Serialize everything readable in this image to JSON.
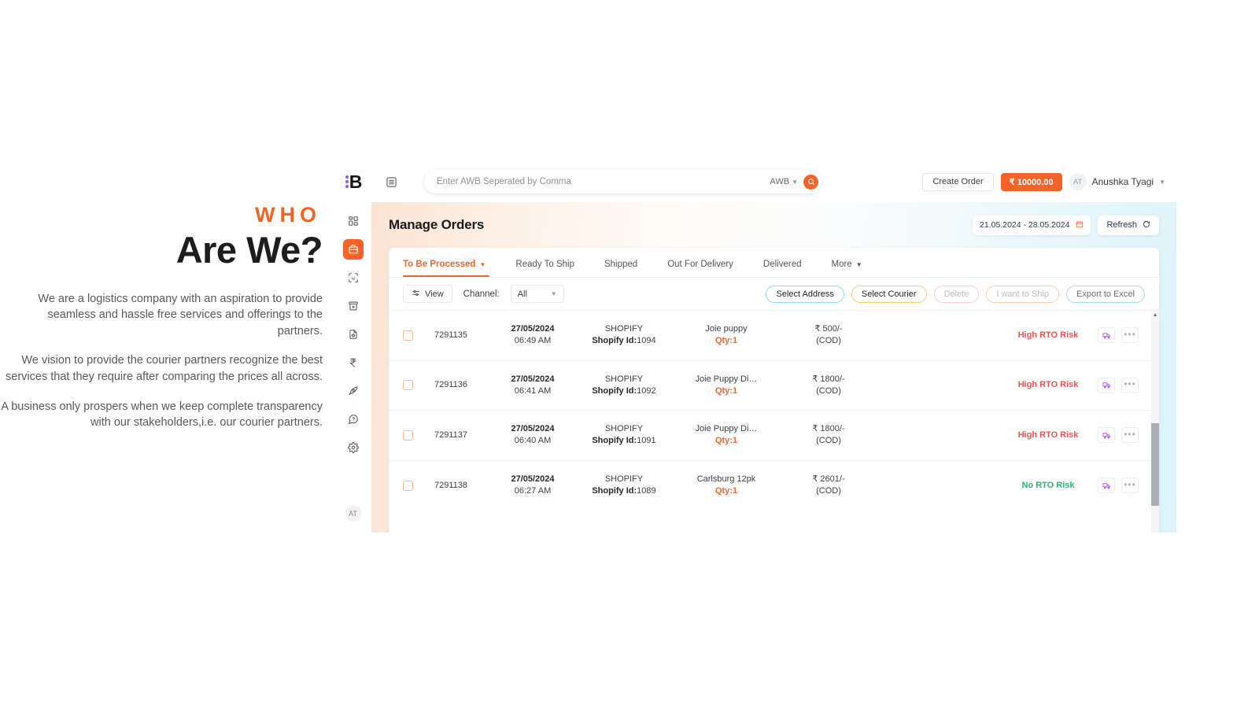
{
  "promo": {
    "kicker": "WHO",
    "title": "Are We?",
    "paragraphs": [
      "We are a logistics company with an aspiration to provide seamless and hassle free services and offerings to the partners.",
      "We vision to provide the courier partners recognize the best services that they require after comparing the prices all across.",
      "A business only prospers when we keep complete transparency with our stakeholders,i.e. our courier partners."
    ]
  },
  "colors": {
    "accent_orange": "#F5632A",
    "kicker_orange": "#F26522",
    "purple": "#a855f7",
    "risk_high": "#ef5350",
    "risk_none": "#2bb673"
  },
  "topbar": {
    "logo_letter": "B",
    "search_placeholder": "Enter AWB Seperated by Comma",
    "search_value": "",
    "search_type": "AWB",
    "create_order_label": "Create Order",
    "wallet_label": "₹ 10000.00",
    "user_initials": "AT",
    "user_name": "Anushka Tyagi"
  },
  "sidebar": {
    "items": [
      {
        "name": "dashboard-icon",
        "label": "Dashboard",
        "active": false
      },
      {
        "name": "orders-icon",
        "label": "Orders",
        "active": true
      },
      {
        "name": "scan-icon",
        "label": "Scan",
        "active": false
      },
      {
        "name": "archive-icon",
        "label": "Archive",
        "active": false
      },
      {
        "name": "document-settings-icon",
        "label": "Documents",
        "active": false
      },
      {
        "name": "rupee-icon",
        "label": "Billing",
        "active": false
      },
      {
        "name": "pen-icon",
        "label": "Tools",
        "active": false
      },
      {
        "name": "help-icon",
        "label": "Help",
        "active": false
      },
      {
        "name": "gear-icon",
        "label": "Settings",
        "active": false
      }
    ],
    "avatar_initials": "AT"
  },
  "page": {
    "title": "Manage Orders",
    "date_range": "21.05.2024 - 28.05.2024",
    "refresh_label": "Refresh"
  },
  "tabs": [
    {
      "label": "To Be Processed",
      "active": true,
      "caret": true
    },
    {
      "label": "Ready To Ship",
      "active": false,
      "caret": false
    },
    {
      "label": "Shipped",
      "active": false,
      "caret": false
    },
    {
      "label": "Out For Delivery",
      "active": false,
      "caret": false
    },
    {
      "label": "Delivered",
      "active": false,
      "caret": false
    },
    {
      "label": "More",
      "active": false,
      "caret": true
    }
  ],
  "filterbar": {
    "view_label": "View",
    "channel_label": "Channel:",
    "channel_value": "All",
    "actions": [
      {
        "label": "Select Address",
        "style": "addr",
        "enabled": true
      },
      {
        "label": "Select Courier",
        "style": "courier",
        "enabled": true
      },
      {
        "label": "Delete",
        "style": "del",
        "enabled": false
      },
      {
        "label": "I want to Ship",
        "style": "ship",
        "enabled": false
      },
      {
        "label": "Export to Excel",
        "style": "export",
        "enabled": true
      }
    ]
  },
  "table": {
    "rows": [
      {
        "order_id": "7291135",
        "date": "27/05/2024",
        "time": "06:49 AM",
        "channel": "SHOPIFY",
        "channel_id_label": "Shopify Id:",
        "channel_id": "1094",
        "product": "Joie puppy",
        "qty": "Qty:1",
        "amount": "₹ 500/-",
        "payment": "(COD)",
        "rto": "High RTO Risk",
        "rto_level": "high"
      },
      {
        "order_id": "7291136",
        "date": "27/05/2024",
        "time": "06:41 AM",
        "channel": "SHOPIFY",
        "channel_id_label": "Shopify Id:",
        "channel_id": "1092",
        "product": "Joie Puppy Di…",
        "qty": "Qty:1",
        "amount": "₹ 1800/-",
        "payment": "(COD)",
        "rto": "High RTO Risk",
        "rto_level": "high"
      },
      {
        "order_id": "7291137",
        "date": "27/05/2024",
        "time": "06:40 AM",
        "channel": "SHOPIFY",
        "channel_id_label": "Shopify Id:",
        "channel_id": "1091",
        "product": "Joie Puppy Di…",
        "qty": "Qty:1",
        "amount": "₹ 1800/-",
        "payment": "(COD)",
        "rto": "High RTO Risk",
        "rto_level": "high"
      },
      {
        "order_id": "7291138",
        "date": "27/05/2024",
        "time": "06:27 AM",
        "channel": "SHOPIFY",
        "channel_id_label": "Shopify Id:",
        "channel_id": "1089",
        "product": "Carlsburg 12pk",
        "qty": "Qty:1",
        "amount": "₹ 2601/-",
        "payment": "(COD)",
        "rto": "No RTO Risk",
        "rto_level": "none"
      }
    ]
  }
}
